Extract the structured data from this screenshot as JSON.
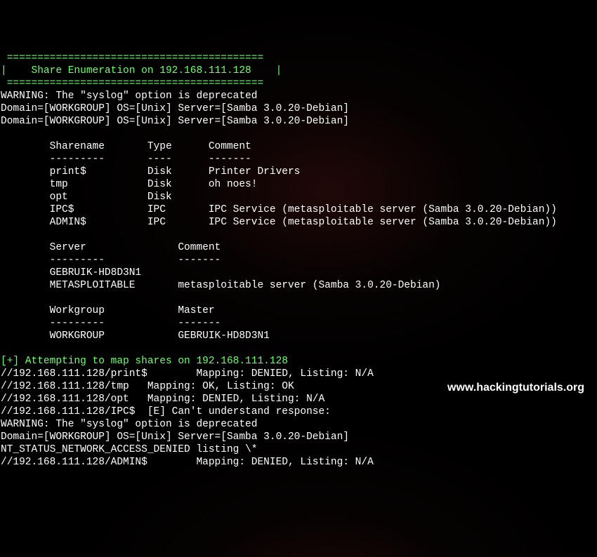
{
  "header": {
    "border": " ========================================== ",
    "title": "|    Share Enumeration on 192.168.111.128    |",
    "border2": " ========================================== "
  },
  "warning1": "WARNING: The \"syslog\" option is deprecated",
  "domain_line1": "Domain=[WORKGROUP] OS=[Unix] Server=[Samba 3.0.20-Debian]",
  "domain_line2": "Domain=[WORKGROUP] OS=[Unix] Server=[Samba 3.0.20-Debian]",
  "shares_header": "        Sharename       Type      Comment",
  "shares_divider": "        ---------       ----      -------",
  "shares": {
    "r0": "        print$          Disk      Printer Drivers",
    "r1": "        tmp             Disk      oh noes!",
    "r2": "        opt             Disk      ",
    "r3": "        IPC$            IPC       IPC Service (metasploitable server (Samba 3.0.20-Debian))",
    "r4": "        ADMIN$          IPC       IPC Service (metasploitable server (Samba 3.0.20-Debian))"
  },
  "server_header": "        Server               Comment",
  "server_divider": "        ---------            -------",
  "servers": {
    "r0": "        GEBRUIK-HD8D3N1",
    "r1": "        METASPLOITABLE       metasploitable server (Samba 3.0.20-Debian)"
  },
  "workgroup_header": "        Workgroup            Master",
  "workgroup_divider": "        ---------            -------",
  "workgroups": {
    "r0": "        WORKGROUP            GEBRUIK-HD8D3N1"
  },
  "attempt_line": "[+] Attempting to map shares on 192.168.111.128",
  "mappings": {
    "m0": "//192.168.111.128/print$        Mapping: DENIED, Listing: N/A",
    "m1": "//192.168.111.128/tmp   Mapping: OK, Listing: OK",
    "m2": "//192.168.111.128/opt   Mapping: DENIED, Listing: N/A",
    "m3": "//192.168.111.128/IPC$  [E] Can't understand response:"
  },
  "warning2": "WARNING: The \"syslog\" option is deprecated",
  "domain_line3": "Domain=[WORKGROUP] OS=[Unix] Server=[Samba 3.0.20-Debian]",
  "nt_status": "NT_STATUS_NETWORK_ACCESS_DENIED listing \\*",
  "mapping_admin": "//192.168.111.128/ADMIN$        Mapping: DENIED, Listing: N/A",
  "watermark": "www.hackingtutorials.org"
}
